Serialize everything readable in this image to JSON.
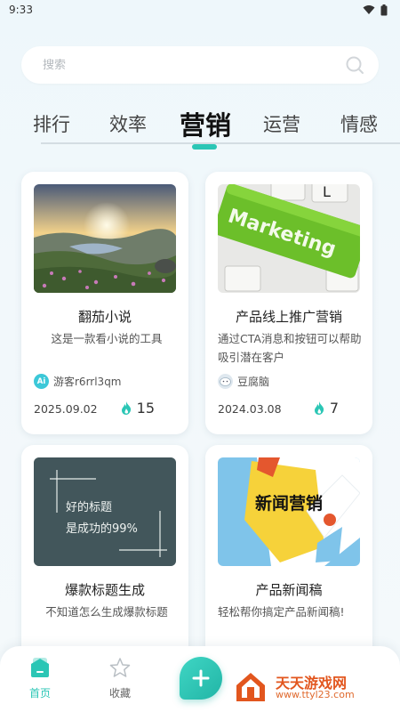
{
  "status_bar": {
    "time": "9:33"
  },
  "search": {
    "placeholder": "搜索"
  },
  "tabs": [
    {
      "label": "排行",
      "active": false
    },
    {
      "label": "效率",
      "active": false
    },
    {
      "label": "营销",
      "active": true
    },
    {
      "label": "运营",
      "active": false
    },
    {
      "label": "情感",
      "active": false
    }
  ],
  "accent_color": "#2bc6b5",
  "cards": [
    {
      "title": "翻茄小说",
      "description": "这是一款看小说的工具",
      "author": "游客r6rrl3qm",
      "author_avatar_text": "Ai",
      "date": "2025.09.02",
      "likes": "15",
      "image": "sunset-landscape"
    },
    {
      "title": "产品线上推广营销",
      "description": "通过CTA消息和按钮可以帮助吸引潜在客户",
      "author": "豆腐脑",
      "date": "2024.03.08",
      "likes": "7",
      "image": "marketing-keyboard",
      "image_text": "Marketing"
    },
    {
      "title": "爆款标题生成",
      "description": "不知道怎么生成爆款标题",
      "image": "chalkboard",
      "image_text_line1": "好的标题",
      "image_text_line2": "是成功的99%"
    },
    {
      "title": "产品新闻稿",
      "description": "轻松帮你搞定产品新闻稿!",
      "image": "news-marketing",
      "image_text": "新闻营销"
    }
  ],
  "nav": {
    "home_label": "首页",
    "favorites_label": "收藏",
    "active": "首页"
  },
  "watermark": {
    "text": "天天游戏网",
    "url": "www.ttyl23.com"
  }
}
